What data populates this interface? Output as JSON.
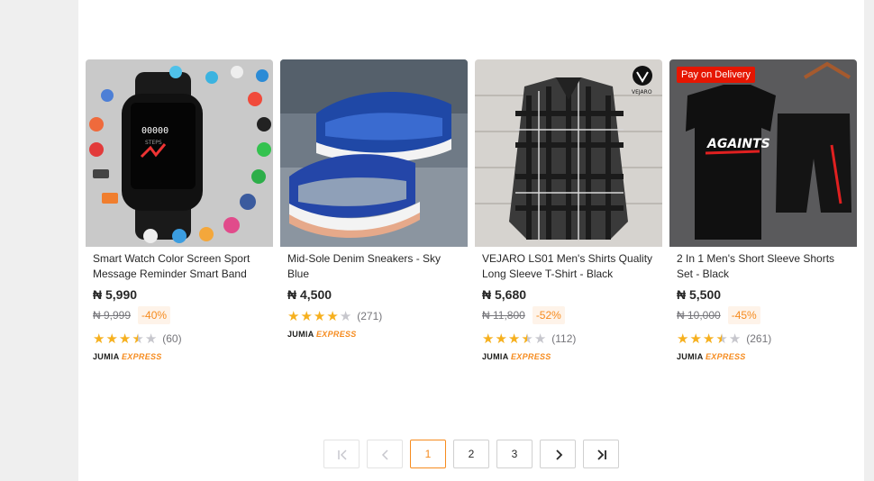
{
  "products": [
    {
      "name": "Smart Watch Color Screen Sport Message Reminder Smart Band",
      "price": "₦ 5,990",
      "old_price": "₦ 9,999",
      "discount": "-40%",
      "rating": 3.5,
      "reviews": "(60)",
      "express": {
        "brand": "JUMIA",
        "label": "EXPRESS"
      }
    },
    {
      "name": "Mid-Sole Denim Sneakers - Sky Blue",
      "price": "₦ 4,500",
      "rating": 4,
      "reviews": "(271)",
      "express": {
        "brand": "JUMIA",
        "label": "EXPRESS"
      }
    },
    {
      "name": "VEJARO LS01 Men's Shirts Quality Long Sleeve T-Shirt - Black",
      "price": "₦ 5,680",
      "old_price": "₦ 11,800",
      "discount": "-52%",
      "rating": 3.5,
      "reviews": "(112)",
      "brand_logo": "VEJARO",
      "express": {
        "brand": "JUMIA",
        "label": "EXPRESS"
      }
    },
    {
      "name": "2 In 1 Men's Short Sleeve Shorts Set - Black",
      "price": "₦ 5,500",
      "old_price": "₦ 10,000",
      "discount": "-45%",
      "rating": 3.5,
      "reviews": "(261)",
      "badge": "Pay on Delivery",
      "print_text": "AGAINTS",
      "express": {
        "brand": "JUMIA",
        "label": "EXPRESS"
      }
    }
  ],
  "pagination": {
    "pages": [
      "1",
      "2",
      "3"
    ],
    "current": "1",
    "icons": [
      "first-page-icon",
      "prev-page-icon",
      "next-page-icon",
      "last-page-icon"
    ]
  },
  "colors": {
    "accent": "#f68b1e",
    "badge": "#e61601",
    "star": "#f6b01e"
  }
}
